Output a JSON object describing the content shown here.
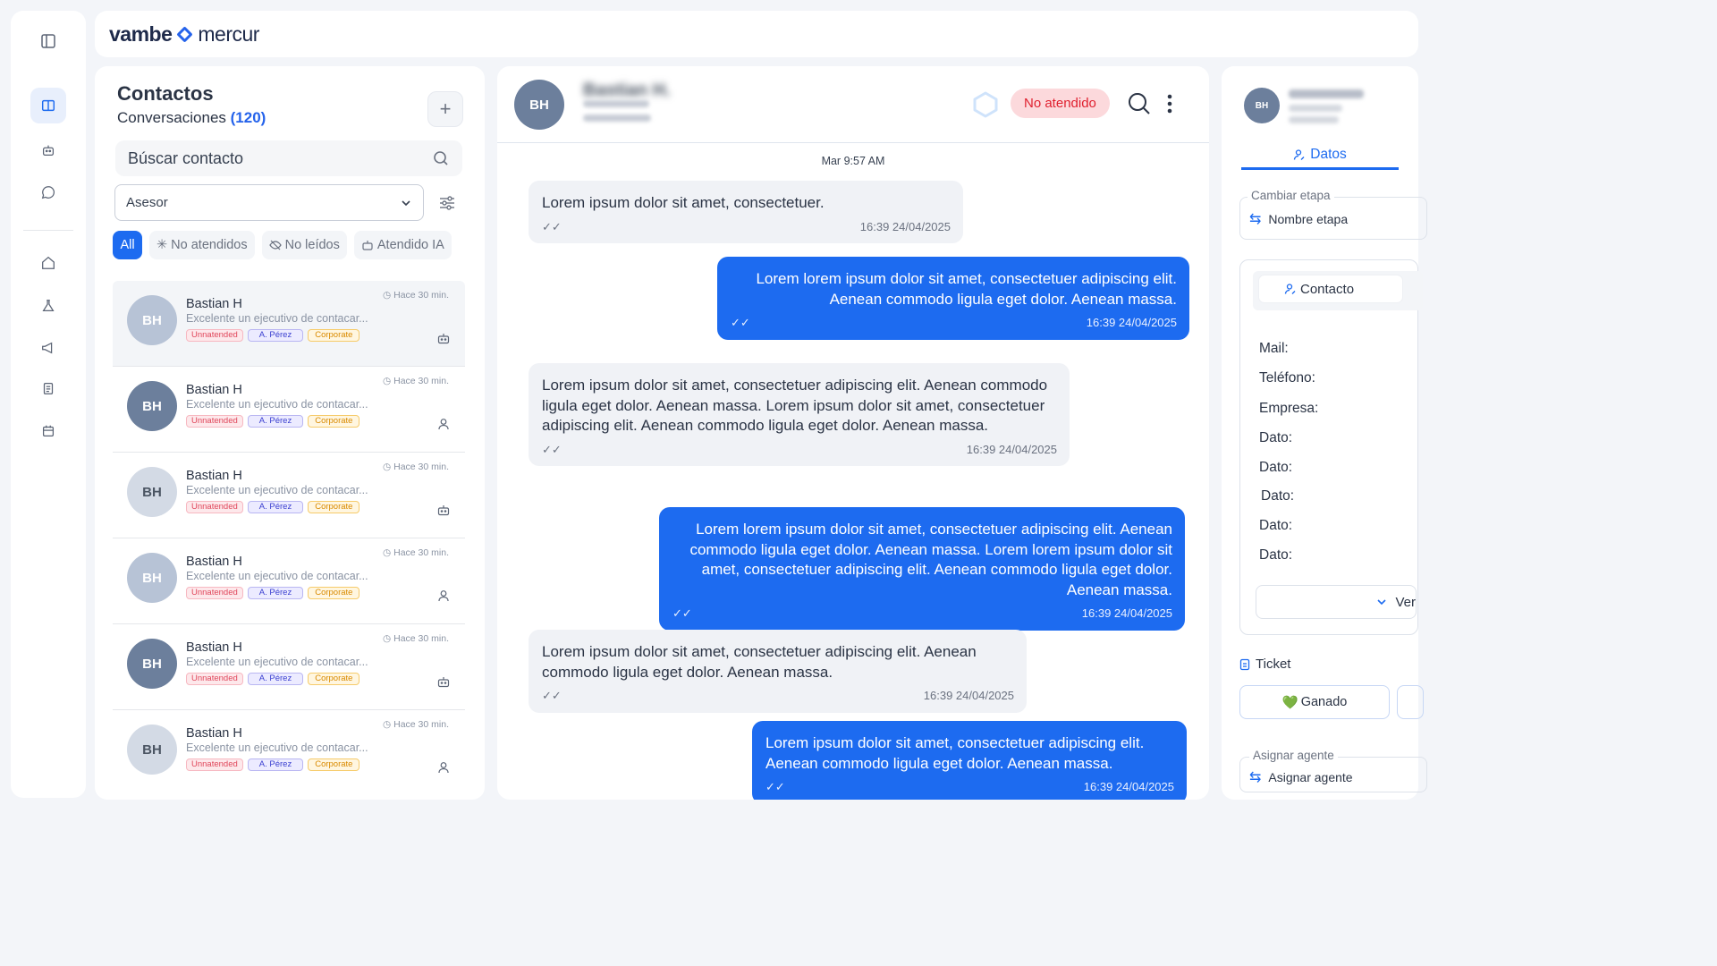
{
  "brand": {
    "name_a": "vambe",
    "name_b": "mercur",
    "accent": "#1d6bf0"
  },
  "rail": {
    "icons": [
      "sidebar-toggle-icon",
      "columns-icon",
      "robot-icon",
      "chat-bubble-icon",
      "home-icon",
      "flask-icon",
      "megaphone-icon",
      "clipboard-icon",
      "calendar-icon"
    ]
  },
  "contacts": {
    "title": "Contactos",
    "subtitle": "Conversaciones",
    "count": "(120)",
    "add_label": "+",
    "search_placeholder": "Búscar contacto",
    "select_value": "Asesor",
    "chips": {
      "all": "All",
      "unattended": "No atendidos",
      "unread": "No leídos",
      "ai": "Atendido IA"
    },
    "rows": [
      {
        "initials": "BH",
        "name": "Bastian H",
        "message": "Excelente un ejecutivo de contacar...",
        "time": "Hace 30 min.",
        "tags": [
          "Unnatended",
          "A. Pérez",
          "Corporate"
        ],
        "icon": "robot-icon"
      },
      {
        "initials": "BH",
        "name": "Bastian H",
        "message": "Excelente un ejecutivo de contacar...",
        "time": "Hace 30 min.",
        "tags": [
          "Unnatended",
          "A. Pérez",
          "Corporate"
        ],
        "icon": "user-icon"
      },
      {
        "initials": "BH",
        "name": "Bastian H",
        "message": "Excelente un ejecutivo de contacar...",
        "time": "Hace 30 min.",
        "tags": [
          "Unnatended",
          "A. Pérez",
          "Corporate"
        ],
        "icon": "robot-icon"
      },
      {
        "initials": "BH",
        "name": "Bastian H",
        "message": "Excelente un ejecutivo de contacar...",
        "time": "Hace 30 min.",
        "tags": [
          "Unnatended",
          "A. Pérez",
          "Corporate"
        ],
        "icon": "user-icon"
      },
      {
        "initials": "BH",
        "name": "Bastian H",
        "message": "Excelente un ejecutivo de contacar...",
        "time": "Hace 30 min.",
        "tags": [
          "Unnatended",
          "A. Pérez",
          "Corporate"
        ],
        "icon": "robot-icon"
      },
      {
        "initials": "BH",
        "name": "Bastian H",
        "message": "Excelente un ejecutivo de contacar...",
        "time": "Hace 30 min.",
        "tags": [
          "Unnatended",
          "A. Pérez",
          "Corporate"
        ],
        "icon": "user-icon"
      }
    ]
  },
  "chat": {
    "initials": "BH",
    "contact_name": "Bastian H.",
    "status": "No atendido",
    "date_separator": "Mar 9:57 AM",
    "messages": [
      {
        "dir": "in",
        "text": "Lorem ipsum dolor sit amet, consectetuer.",
        "time": "16:39 24/04/2025"
      },
      {
        "dir": "out",
        "text": "Lorem lorem ipsum dolor sit amet, consectetuer adipiscing elit. Aenean commodo ligula eget dolor. Aenean massa.",
        "time": "16:39 24/04/2025"
      },
      {
        "dir": "in",
        "text": "Lorem ipsum dolor sit amet, consectetuer adipiscing elit. Aenean commodo ligula eget dolor. Aenean massa. Lorem ipsum dolor sit amet, consectetuer adipiscing elit. Aenean commodo ligula eget dolor. Aenean massa.",
        "time": "16:39 24/04/2025"
      },
      {
        "dir": "out",
        "text": "Lorem lorem ipsum dolor sit amet, consectetuer adipiscing elit. Aenean commodo ligula eget dolor. Aenean massa. Lorem lorem ipsum dolor sit amet, consectetuer adipiscing elit. Aenean commodo ligula eget dolor. Aenean massa.",
        "time": "16:39 24/04/2025"
      },
      {
        "dir": "in",
        "text": "Lorem ipsum dolor sit amet, consectetuer adipiscing elit. Aenean commodo ligula eget dolor. Aenean massa.",
        "time": "16:39 24/04/2025"
      },
      {
        "dir": "out",
        "text": "Lorem ipsum dolor sit amet, consectetuer adipiscing elit. Aenean commodo ligula eget dolor. Aenean massa.",
        "time": "16:39 24/04/2025"
      }
    ]
  },
  "side": {
    "initials": "BH",
    "tab_datos": "Datos",
    "etapa_legend": "Cambiar etapa",
    "etapa_value": "Nombre etapa",
    "contact_tab": "Contacto",
    "fields": [
      "Mail:",
      "Teléfono:",
      "Empresa:",
      "Dato:",
      "Dato:",
      "Dato:",
      "Dato:",
      "Dato:"
    ],
    "ver_label": "Ver",
    "ticket_label": "Ticket",
    "ganado_label": "Ganado",
    "ganado_emoji": "💚",
    "agente_legend": "Asignar agente",
    "agente_value": "Asignar agente"
  }
}
